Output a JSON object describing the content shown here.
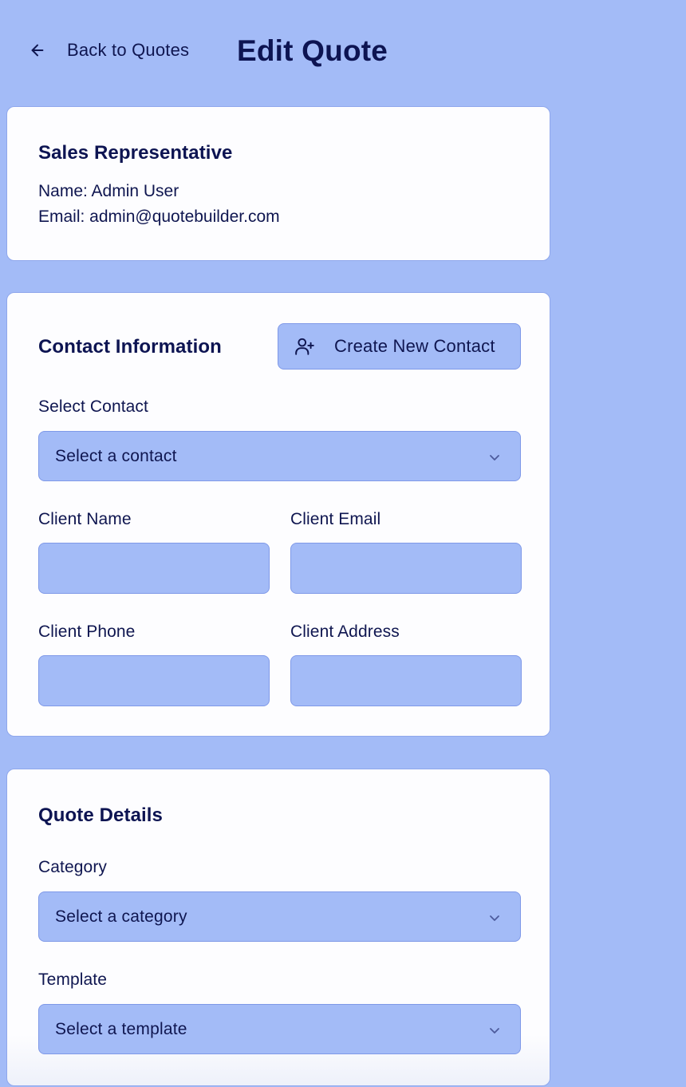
{
  "header": {
    "back_label": "Back to Quotes",
    "title": "Edit Quote"
  },
  "sales_rep": {
    "title": "Sales Representative",
    "name_line": "Name: Admin User",
    "email_line": "Email: admin@quotebuilder.com"
  },
  "contact": {
    "title": "Contact Information",
    "create_button_label": "Create New Contact",
    "select_label": "Select Contact",
    "select_value": "Select a contact",
    "fields": {
      "client_name_label": "Client Name",
      "client_name_value": "",
      "client_email_label": "Client Email",
      "client_email_value": "",
      "client_phone_label": "Client Phone",
      "client_phone_value": "",
      "client_address_label": "Client Address",
      "client_address_value": ""
    }
  },
  "quote_details": {
    "title": "Quote Details",
    "category_label": "Category",
    "category_value": "Select a category",
    "template_label": "Template",
    "template_value": "Select a template"
  },
  "icons": {
    "back": "arrow-left-icon",
    "create_contact": "user-plus-icon",
    "dropdown": "chevron-down-icon"
  },
  "colors": {
    "background": "#a3bbf7",
    "card": "#fdfdff",
    "text": "#0f1650",
    "border": "#7f99e8"
  }
}
